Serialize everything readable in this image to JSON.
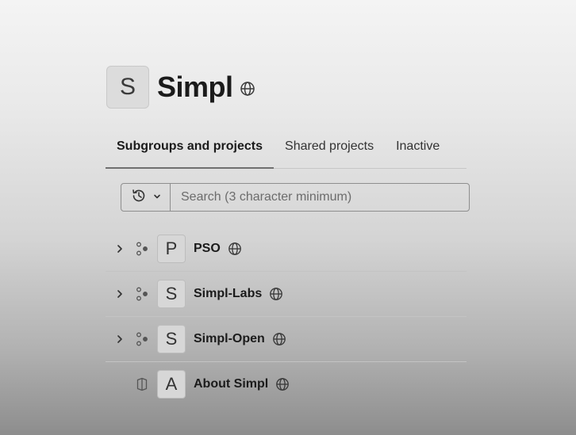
{
  "group": {
    "avatar_letter": "S",
    "title": "Simpl",
    "visibility_icon": "globe-icon"
  },
  "tabs": [
    {
      "label": "Subgroups and projects",
      "active": true
    },
    {
      "label": "Shared projects",
      "active": false
    },
    {
      "label": "Inactive",
      "active": false
    }
  ],
  "search": {
    "placeholder": "Search (3 character minimum)",
    "value": "",
    "sort_icon": "history-icon"
  },
  "rows": [
    {
      "type": "subgroup",
      "type_icon": "subgroup-icon",
      "expandable": true,
      "avatar_letter": "P",
      "name": "PSO",
      "visibility_icon": "globe-icon"
    },
    {
      "type": "subgroup",
      "type_icon": "subgroup-icon",
      "expandable": true,
      "avatar_letter": "S",
      "name": "Simpl-Labs",
      "visibility_icon": "globe-icon"
    },
    {
      "type": "subgroup",
      "type_icon": "subgroup-icon",
      "expandable": true,
      "avatar_letter": "S",
      "name": "Simpl-Open",
      "visibility_icon": "globe-icon"
    },
    {
      "type": "project",
      "type_icon": "project-icon",
      "expandable": false,
      "avatar_letter": "A",
      "name": "About Simpl",
      "visibility_icon": "globe-icon"
    }
  ]
}
